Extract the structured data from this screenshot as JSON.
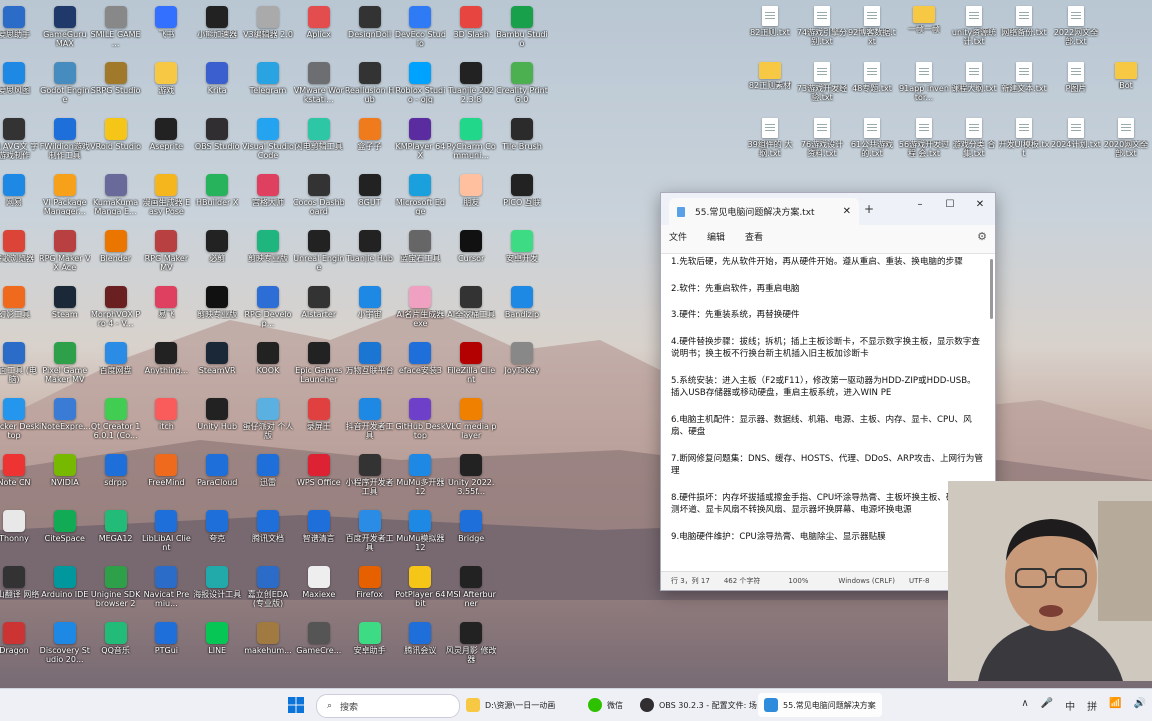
{
  "desktop_left": [
    [
      [
        "爱思助手",
        "#2a6cc7"
      ],
      [
        "GameGuru MAX",
        "#1f3a6a"
      ],
      [
        "SMILE GAME ...",
        "#888"
      ],
      [
        "飞书",
        "#3370ff"
      ],
      [
        "小熊加速器",
        "#222"
      ],
      [
        "V3编辑器 2.0",
        "#aaa"
      ],
      [
        "Aplicx",
        "#e34d4d"
      ],
      [
        "DesignDoll",
        "#333"
      ],
      [
        "DevEco Studio",
        "#2f7bf5"
      ],
      [
        "3D Slash",
        "#e6463f"
      ],
      [
        "Bambu Studio",
        "#18a04a"
      ]
    ],
    [
      [
        "爱思风图",
        "#1e88e5"
      ],
      [
        "Godot Engine",
        "#478cbf"
      ],
      [
        "SRPG Studio",
        "#a07a2a"
      ],
      [
        "游戏",
        "#f7c843"
      ],
      [
        "Krita",
        "#3b5fcf"
      ],
      [
        "Telegram",
        "#2aa3e2"
      ],
      [
        "VMware Workstati...",
        "#6d6e71"
      ],
      [
        "Reallusion Hub",
        "#333"
      ],
      [
        "Roblox Studio - ojq",
        "#00a2ff"
      ],
      [
        "Tuanjie 2022.3.8",
        "#222"
      ],
      [
        "Creality Print 6.0",
        "#4caf50"
      ]
    ],
    [
      [
        "LN AVG文 字游戏制作",
        "#333"
      ],
      [
        "FWildion游戏 制作工具",
        "#1e6fd9"
      ],
      [
        "VRoid Studio",
        "#f5c518"
      ],
      [
        "Aseprite",
        "#222"
      ],
      [
        "OBS Studio",
        "#302e31"
      ],
      [
        "Visual Studio Code",
        "#23a3f0"
      ],
      [
        "闪电剪辑工具",
        "#2ec7a6"
      ],
      [
        "盒子子",
        "#f07b1d"
      ],
      [
        "KMPlayer 64X",
        "#5a2ca0"
      ],
      [
        "PyCharm Communi...",
        "#21d789"
      ],
      [
        "Tile Brush",
        "#2b2b2b"
      ]
    ],
    [
      [
        "网易",
        "#1e88e5"
      ],
      [
        "VI Package Manager...",
        "#f7a11a"
      ],
      [
        "KumaKuma Manga E...",
        "#6a6a9a"
      ],
      [
        "漫画生成器 Easy Pose",
        "#f5b51c"
      ],
      [
        "HBuilder X",
        "#27b35c"
      ],
      [
        "宫格大师",
        "#e04060"
      ],
      [
        "Cocos Dashboard",
        "#333"
      ],
      [
        "8GUT",
        "#222"
      ],
      [
        "Microsoft Edge",
        "#1aa0dc"
      ],
      [
        "朋友",
        "#ffc0a0"
      ],
      [
        "PICO 互联",
        "#222"
      ]
    ],
    [
      [
        "谷歌浏览器",
        "#db4437"
      ],
      [
        "RPG Maker VX Ace",
        "#b84040"
      ],
      [
        "Blender",
        "#ea7600"
      ],
      [
        "RPG Maker MV",
        "#b84040"
      ],
      [
        "必剪",
        "#222"
      ],
      [
        "剪映专业版",
        "#1fb57f"
      ],
      [
        "Unreal Engine",
        "#222"
      ],
      [
        "Tuanjie Hub",
        "#222"
      ],
      [
        "蓝宝石工具",
        "#666"
      ],
      [
        "Cursor",
        "#111"
      ],
      [
        "安卓开发",
        "#3ddc84"
      ]
    ],
    [
      [
        "幻影工具",
        "#f06a1d"
      ],
      [
        "Steam",
        "#1b2838"
      ],
      [
        "MorphVOX Pro 4 - V...",
        "#6a2020"
      ],
      [
        "易飞",
        "#e04060"
      ],
      [
        "剪映专业版",
        "#111"
      ],
      [
        "RPG Develop...",
        "#2d6ed6"
      ],
      [
        "AIstarter",
        "#333"
      ],
      [
        "小宇宙",
        "#1e88e5"
      ],
      [
        "AI名片生成器 exe",
        "#f0a0c0"
      ],
      [
        "AI全家桶工具",
        "#333"
      ],
      [
        "Bandizip",
        "#1e88e5"
      ]
    ],
    [
      [
        "桌面工具 (电脑)",
        "#2a6cc7"
      ],
      [
        "Pixel Game Maker MV",
        "#2ea04a"
      ],
      [
        "百度网盘",
        "#2b8ce6"
      ],
      [
        "Anything...",
        "#222"
      ],
      [
        "SteamVR",
        "#1b2838"
      ],
      [
        "KOOK",
        "#222"
      ],
      [
        "Epic Games Launcher",
        "#222"
      ],
      [
        "万物互联平台",
        "#1b76d3"
      ],
      [
        "eface安装3",
        "#1e6fd9"
      ],
      [
        "FileZilla Client",
        "#b30000"
      ],
      [
        "JoyToKey",
        "#888"
      ]
    ],
    [
      [
        "Docker Desktop",
        "#2496ed"
      ],
      [
        "iNoteExpre...",
        "#3a7bd5"
      ],
      [
        "Qt Creator 16.0.1 (Co...",
        "#41cd52"
      ],
      [
        "itch",
        "#fa5c5c"
      ],
      [
        "Unity Hub",
        "#222"
      ],
      [
        "蛋仔派对 个人版",
        "#5ab0e0"
      ],
      [
        "录屏王",
        "#e04040"
      ],
      [
        "抖音开发者工具",
        "#1e88e5"
      ],
      [
        "GitHub Desktop",
        "#6e40c9"
      ],
      [
        "VLC media player",
        "#f08000"
      ]
    ],
    [
      [
        "Note CN",
        "#e33"
      ],
      [
        "NVIDIA",
        "#76b900"
      ],
      [
        "sdrpp",
        "#1e6fd9"
      ],
      [
        "FreeMind",
        "#f06a1d"
      ],
      [
        "ParaCloud",
        "#1e6fd9"
      ],
      [
        "迅雷",
        "#1e6fd9"
      ],
      [
        "WPS Office",
        "#d23"
      ],
      [
        "小程序开发者工具",
        "#333"
      ],
      [
        "MuMu多开器12",
        "#1e88e5"
      ],
      [
        "Unity 2022.3.55f...",
        "#222"
      ]
    ],
    [
      [
        "Thonny",
        "#e8e8e8"
      ],
      [
        "CiteSpace",
        "#1a5"
      ],
      [
        "MEGA12",
        "#2b7"
      ],
      [
        "LibLibAI Client",
        "#1e6fd9"
      ],
      [
        "夸克",
        "#1e6fd9"
      ],
      [
        "腾讯文档",
        "#1e6fd9"
      ],
      [
        "智谱清言",
        "#1e6fd9"
      ],
      [
        "百度开发者工具",
        "#2b8ce6"
      ],
      [
        "MuMu模拟器12",
        "#1e88e5"
      ],
      [
        "Bridge",
        "#1e6fd9"
      ]
    ],
    [
      [
        "火山翻译 网络",
        "#333"
      ],
      [
        "Arduino IDE",
        "#00979d"
      ],
      [
        "Unigine SDK browser 2",
        "#2ea04a"
      ],
      [
        "Navicat Premiu...",
        "#2a6cc7"
      ],
      [
        "海报设计工具",
        "#2aa"
      ],
      [
        "嘉立创EDA (专业版)",
        "#2a6cc7"
      ],
      [
        "Maxiexe",
        "#eee"
      ],
      [
        "Firefox",
        "#e66000"
      ],
      [
        "PotPlayer 64 bit",
        "#f5c518"
      ],
      [
        "MSI Afterburner",
        "#222"
      ]
    ],
    [
      [
        "Dragon",
        "#c33"
      ],
      [
        "Discovery Studio 20...",
        "#1e88e5"
      ],
      [
        "QQ音乐",
        "#2b7"
      ],
      [
        "PTGui",
        "#1e6fd9"
      ],
      [
        "LINE",
        "#06c755"
      ],
      [
        "makehum...",
        "#a07a40"
      ],
      [
        "GameCre...",
        "#555"
      ],
      [
        "安卓助手",
        "#3ddc84"
      ],
      [
        "腾讯会议",
        "#1e6fd9"
      ],
      [
        "风灵月影 修改器",
        "#222"
      ]
    ]
  ],
  "desktop_right": [
    [
      "82正则.txt",
      "74游戏引擎分别.txt",
      "92博客数据.txt",
      "一帧一帧",
      "unity资源统计.txt",
      "网络备份.txt",
      "2022网文全部.txt"
    ],
    [
      "82正则素材",
      "73游戏开发经验.txt",
      "48专题.txt",
      "91app inventor...",
      "课程大纲.txt",
      "新建文本.txt",
      "P图片",
      "Bot"
    ],
    [
      "39组件的 大纲.txt",
      "76游戏设计 资料.txt",
      "61公共游戏 的.txt",
      "56游戏开发过程 会.txt",
      "游戏分类 合集.txt",
      "开发UI模板.txt",
      "2024计划.txt",
      "2020网文全部.txt"
    ]
  ],
  "notepad": {
    "tab_title": "55.常见电脑问题解决方案.txt",
    "close_symbol": "✕",
    "plus_symbol": "+",
    "win_min": "–",
    "win_max": "☐",
    "win_close": "✕",
    "menu": {
      "file": "文件",
      "edit": "编辑",
      "view": "查看"
    },
    "lines": [
      "1.先软后硬，先从软件开始，再从硬件开始。遵从重启、重装、换电脑的步骤",
      "2.软件：先重启软件，再重启电脑",
      "3.硬件：先重装系统，再替换硬件",
      "4.硬件替换步骤：拔线；拆机；插上主板诊断卡，不显示数字换主板，显示数字查说明书；换主板不行换台新主机插入旧主板加诊断卡",
      "5.系统安装：进入主板（F2或F11），修改第一驱动器为HDD-ZIP或HDD-USB。插入USB存储器或移动硬盘，重启主板系统，进入WIN PE",
      "6.电脑主机配件：显示器、数据线、机箱、电源、主板、内存、显卡、CPU、风扇、硬盘",
      "7.断网修复问题集：DNS、缓存、HOSTS、代理、DDoS、ARP攻击、上网行为管理",
      "8.硬件损坏：内存坏拔插或擦金手指、CPU坏涂导热膏、主板坏换主板、硬盘坏检测坏道、显卡风扇不转换风扇、显示器坏换屏幕、电源坏换电源",
      "9.电脑硬件维护：CPU涂导热膏、电脑除尘、显示器贴膜"
    ],
    "status": {
      "pos": "行 3，列 17",
      "chars": "462 个字符",
      "zoom": "100%",
      "eol": "Windows (CRLF)",
      "enc": "UTF-8"
    }
  },
  "taskbar": {
    "search_placeholder": "搜索",
    "items": [
      "D:\\资源\\一日一动画",
      "微信",
      "OBS 30.2.3 - 配置文件: 场",
      "55.常见电脑问题解决方案"
    ],
    "tray": [
      "∧",
      "🎤",
      "中",
      "拼",
      "📶",
      "🔊"
    ]
  },
  "colors": {
    "accent": "#0067c0",
    "taskbar": "#eef0f5"
  }
}
